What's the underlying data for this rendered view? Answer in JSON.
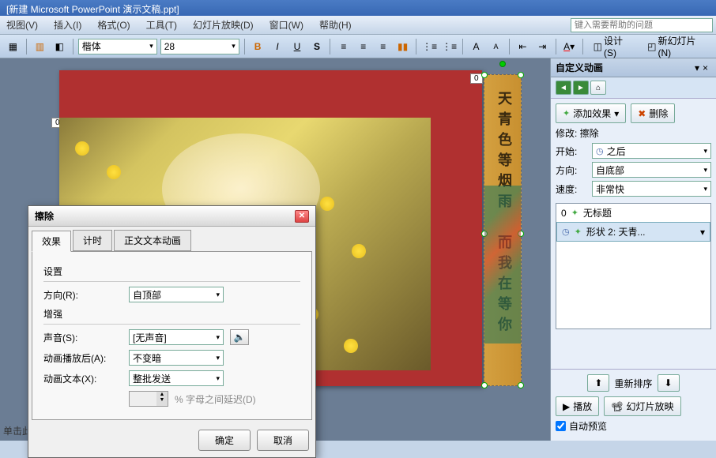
{
  "title": "[新建 Microsoft PowerPoint 演示文稿.ppt]",
  "menu": {
    "view": "视图(V)",
    "insert": "插入(I)",
    "format": "格式(O)",
    "tools": "工具(T)",
    "slideshow": "幻灯片放映(D)",
    "window": "窗口(W)",
    "help": "帮助(H)",
    "help_placeholder": "键入需要帮助的问题"
  },
  "toolbar": {
    "font_name": "楷体",
    "font_size": "28",
    "design": "设计(S)",
    "new_slide": "新幻灯片(N)"
  },
  "slide": {
    "tag0a": "0",
    "tag0b": "0",
    "banner_text": "天青色等烟雨　而我在等你"
  },
  "taskpane": {
    "title": "自定义动画",
    "add_effect": "添加效果",
    "delete": "删除",
    "modify_label": "修改: 擦除",
    "start_label": "开始:",
    "start_value": "之后",
    "direction_label": "方向:",
    "direction_value": "自底部",
    "speed_label": "速度:",
    "speed_value": "非常快",
    "item1_num": "0",
    "item1_text": "无标题",
    "item2_text": "形状 2: 天青...",
    "reorder": "重新排序",
    "play": "播放",
    "slideshow_btn": "幻灯片放映",
    "autopreview": "自动预览"
  },
  "dialog": {
    "title": "擦除",
    "tab_effect": "效果",
    "tab_timing": "计时",
    "tab_textanim": "正文文本动画",
    "group_settings": "设置",
    "direction_label": "方向(R):",
    "direction_value": "自顶部",
    "group_enhance": "增强",
    "sound_label": "声音(S):",
    "sound_value": "[无声音]",
    "after_label": "动画播放后(A):",
    "after_value": "不变暗",
    "anitext_label": "动画文本(X):",
    "anitext_value": "整批发送",
    "delay_hint": "% 字母之间延迟(D)",
    "ok": "确定",
    "cancel": "取消"
  },
  "status": "单击此"
}
